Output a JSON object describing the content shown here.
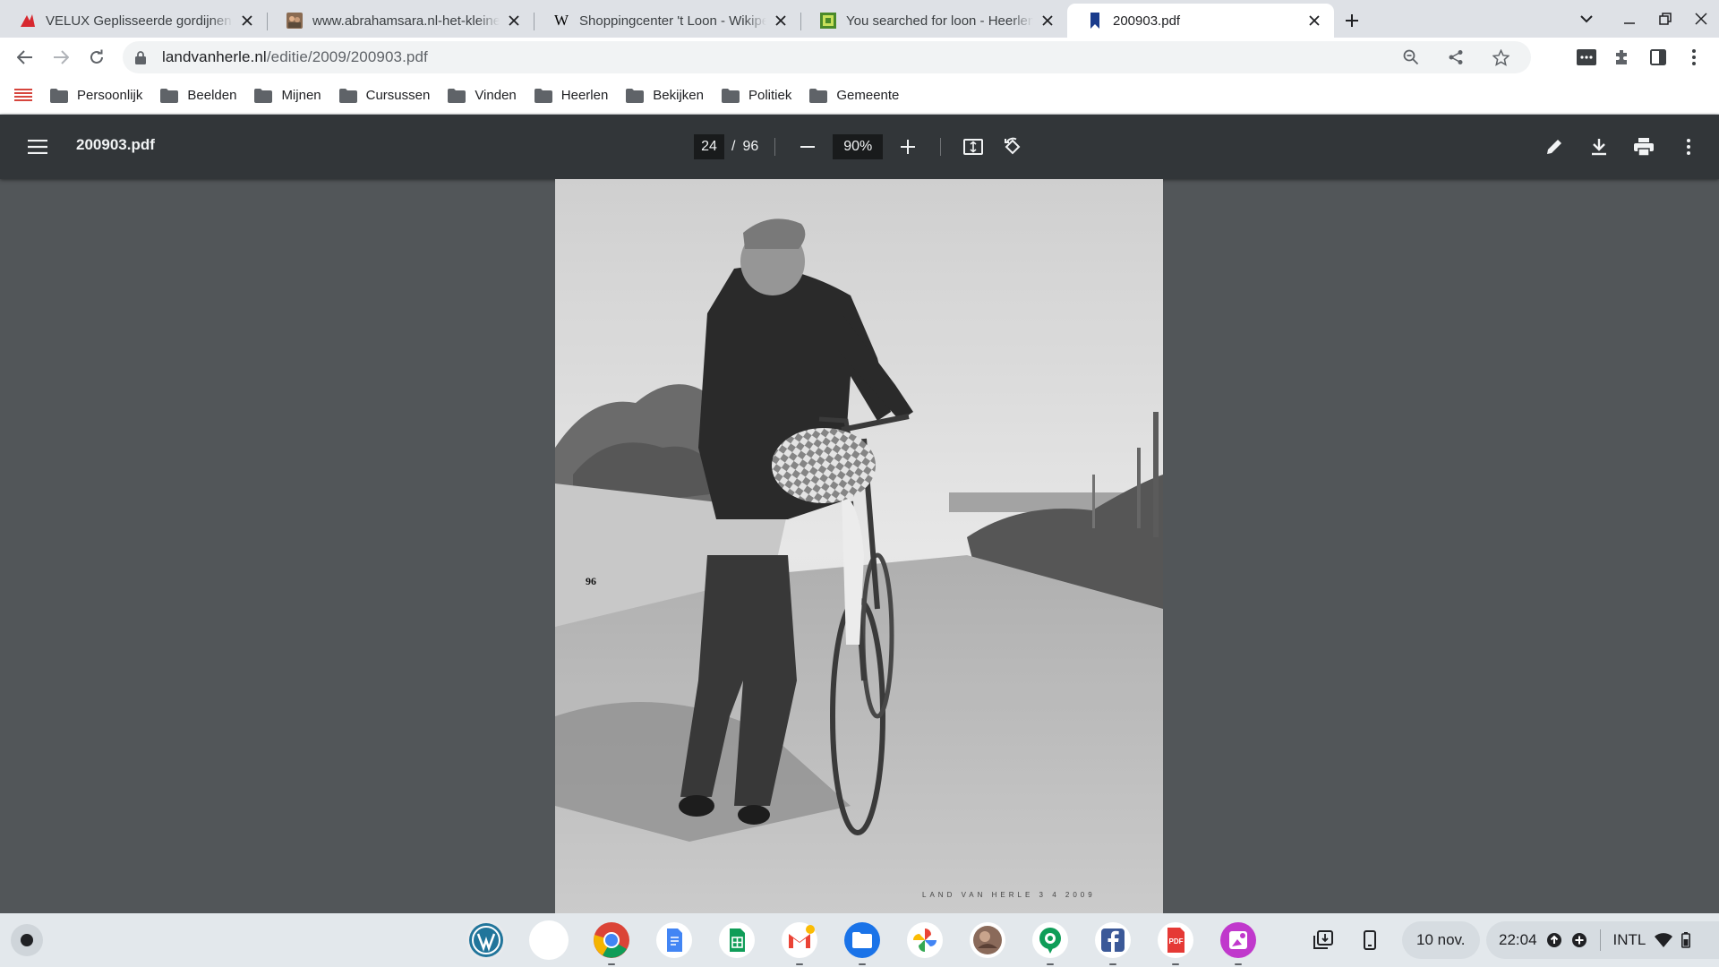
{
  "browser": {
    "tabs": [
      {
        "title": "VELUX Geplisseerde gordijnen | D",
        "favicon": "velux-icon",
        "active": false
      },
      {
        "title": "www.abrahamsara.nl-het-kleine-c",
        "favicon": "photo-icon",
        "active": false
      },
      {
        "title": "Shoppingcenter 't Loon - Wikiped",
        "favicon": "wikipedia-icon",
        "active": false
      },
      {
        "title": "You searched for loon - Heerlen V",
        "favicon": "heerlen-icon",
        "active": false
      },
      {
        "title": "200903.pdf",
        "favicon": "bookmark-icon",
        "active": true
      }
    ],
    "url_host": "landvanherle.nl",
    "url_path": "/editie/2009/200903.pdf",
    "bookmarks": [
      "Persoonlijk",
      "Beelden",
      "Mijnen",
      "Cursussen",
      "Vinden",
      "Heerlen",
      "Bekijken",
      "Politiek",
      "Gemeente"
    ]
  },
  "pdf": {
    "filename": "200903.pdf",
    "current_page": "24",
    "page_separator": "/",
    "total_pages": "96",
    "zoom": "90%",
    "page_number_label": "96",
    "credit": "LAND VAN HERLE 3 4 2009"
  },
  "shelf": {
    "apps": [
      "wordpress-icon",
      "blank-app-icon",
      "chrome-icon",
      "docs-icon",
      "sheets-icon",
      "gmail-icon",
      "files-icon",
      "photos-icon",
      "photo-app-icon",
      "hangouts-icon",
      "facebook-icon",
      "pdf-app-icon",
      "screenshot-app-icon"
    ],
    "date": "10 nov.",
    "time": "22:04",
    "input_method": "INTL"
  },
  "colors": {
    "tabstrip": "#dee1e6",
    "pdf_toolbar": "#323639",
    "viewer_bg": "#525659",
    "shelf": "#e3e8ec"
  }
}
